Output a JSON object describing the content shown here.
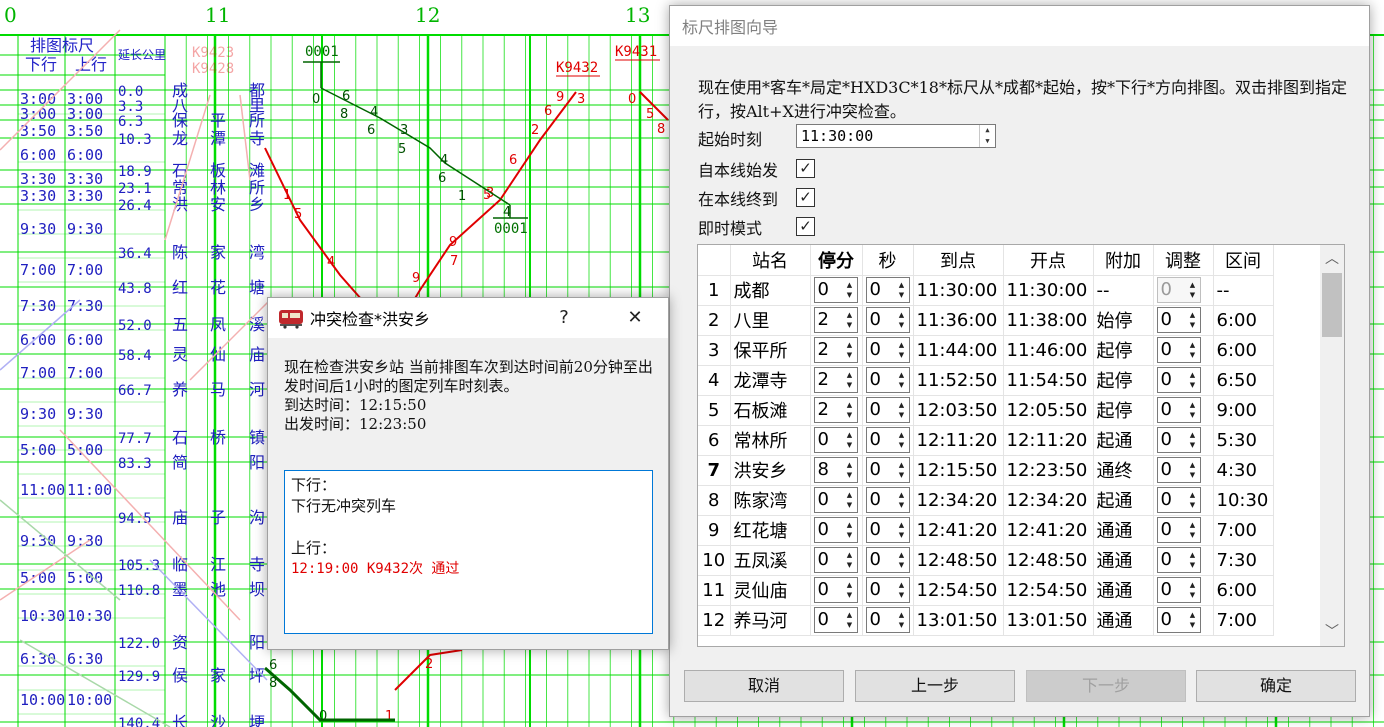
{
  "graph": {
    "hour_labels": [
      "0",
      "11",
      "12",
      "13"
    ],
    "ruler_header": "排图标尺",
    "down_header": "下行",
    "up_header": "上行",
    "km_header": "延长公里",
    "ruler_rows": [
      {
        "down": "3:00",
        "up": "3:00"
      },
      {
        "down": "3:00",
        "up": "3:00"
      },
      {
        "down": "3:50",
        "up": "3:50"
      },
      {
        "down": "6:00",
        "up": "6:00"
      },
      {
        "down": "3:30",
        "up": "3:30"
      },
      {
        "down": "3:30",
        "up": "3:30"
      },
      {
        "down": "9:30",
        "up": "9:30"
      },
      {
        "down": "7:00",
        "up": "7:00"
      },
      {
        "down": "7:30",
        "up": "7:30"
      },
      {
        "down": "6:00",
        "up": "6:00"
      },
      {
        "down": "7:00",
        "up": "7:00"
      },
      {
        "down": "9:30",
        "up": "9:30"
      },
      {
        "down": "5:00",
        "up": "5:00"
      },
      {
        "down": "11:00",
        "up": "11:00"
      },
      {
        "down": "9:30",
        "up": "9:30"
      },
      {
        "down": "5:00",
        "up": "5:00"
      },
      {
        "down": "10:30",
        "up": "10:30"
      },
      {
        "down": "6:30",
        "up": "6:30"
      },
      {
        "down": "10:00",
        "up": "10:00"
      }
    ],
    "stations": [
      {
        "km": "0.0",
        "name": [
          "成",
          "",
          "都"
        ]
      },
      {
        "km": "3.3",
        "name": [
          "八",
          "",
          "里"
        ]
      },
      {
        "km": "6.3",
        "name": [
          "保",
          "平",
          "所"
        ]
      },
      {
        "km": "10.3",
        "name": [
          "龙",
          "潭",
          "寺"
        ]
      },
      {
        "km": "18.9",
        "name": [
          "石",
          "板",
          "滩"
        ]
      },
      {
        "km": "23.1",
        "name": [
          "常",
          "林",
          "所"
        ]
      },
      {
        "km": "26.4",
        "name": [
          "洪",
          "安",
          "乡"
        ]
      },
      {
        "km": "36.4",
        "name": [
          "陈",
          "家",
          "湾"
        ]
      },
      {
        "km": "43.8",
        "name": [
          "红",
          "花",
          "塘"
        ]
      },
      {
        "km": "52.0",
        "name": [
          "五",
          "凤",
          "溪"
        ]
      },
      {
        "km": "58.4",
        "name": [
          "灵",
          "仙",
          "庙"
        ]
      },
      {
        "km": "66.7",
        "name": [
          "养",
          "马",
          "河"
        ]
      },
      {
        "km": "77.7",
        "name": [
          "石",
          "桥",
          "镇"
        ]
      },
      {
        "km": "83.3",
        "name": [
          "简",
          "",
          "阳"
        ]
      },
      {
        "km": "94.5",
        "name": [
          "庙",
          "子",
          "沟"
        ]
      },
      {
        "km": "105.3",
        "name": [
          "临",
          "江",
          "寺"
        ]
      },
      {
        "km": "110.8",
        "name": [
          "墨",
          "池",
          "坝"
        ]
      },
      {
        "km": "122.0",
        "name": [
          "资",
          "",
          "阳"
        ]
      },
      {
        "km": "129.9",
        "name": [
          "侯",
          "家",
          "坪"
        ]
      },
      {
        "km": "140.4",
        "name": [
          "长",
          "沙",
          "埂"
        ]
      }
    ],
    "train_labels": {
      "k9423": "K9423",
      "k9428": "K9428",
      "k9432": "K9432",
      "k9431": "K9431",
      "t0001_top": "0001",
      "t0001_bottom": "0001"
    },
    "colors": {
      "grid": "#00dc00",
      "train_down": "#e00000",
      "train_up": "#006400",
      "text": "#2020c0"
    }
  },
  "wizard": {
    "title": "标尺排图向导",
    "description": "现在使用*客车*局定*HXD3C*18*标尺从*成都*起始，按*下行*方向排图。双击排图到指定行，按Alt+X进行冲突检查。",
    "start_label": "起始时刻",
    "start_value": "11:30:00",
    "origin_label": "自本线始发",
    "terminal_label": "在本线终到",
    "instant_label": "即时模式",
    "check_mark": "✓",
    "columns": [
      "",
      "站名",
      "停分",
      "秒",
      "到点",
      "开点",
      "附加",
      "调整",
      "区间"
    ],
    "rows": [
      {
        "n": "1",
        "station": "成都",
        "stop": "0",
        "sec": "0",
        "arr": "11:30:00",
        "dep": "11:30:00",
        "extra": "--",
        "adj": "0",
        "interval": "--"
      },
      {
        "n": "2",
        "station": "八里",
        "stop": "2",
        "sec": "0",
        "arr": "11:36:00",
        "dep": "11:38:00",
        "extra": "始停",
        "adj": "0",
        "interval": "6:00"
      },
      {
        "n": "3",
        "station": "保平所",
        "stop": "2",
        "sec": "0",
        "arr": "11:44:00",
        "dep": "11:46:00",
        "extra": "起停",
        "adj": "0",
        "interval": "6:00"
      },
      {
        "n": "4",
        "station": "龙潭寺",
        "stop": "2",
        "sec": "0",
        "arr": "11:52:50",
        "dep": "11:54:50",
        "extra": "起停",
        "adj": "0",
        "interval": "6:50"
      },
      {
        "n": "5",
        "station": "石板滩",
        "stop": "2",
        "sec": "0",
        "arr": "12:03:50",
        "dep": "12:05:50",
        "extra": "起停",
        "adj": "0",
        "interval": "9:00"
      },
      {
        "n": "6",
        "station": "常林所",
        "stop": "0",
        "sec": "0",
        "arr": "12:11:20",
        "dep": "12:11:20",
        "extra": "起通",
        "adj": "0",
        "interval": "5:30"
      },
      {
        "n": "7",
        "station": "洪安乡",
        "stop": "8",
        "sec": "0",
        "arr": "12:15:50",
        "dep": "12:23:50",
        "extra": "通终",
        "adj": "0",
        "interval": "4:30"
      },
      {
        "n": "8",
        "station": "陈家湾",
        "stop": "0",
        "sec": "0",
        "arr": "12:34:20",
        "dep": "12:34:20",
        "extra": "起通",
        "adj": "0",
        "interval": "10:30"
      },
      {
        "n": "9",
        "station": "红花塘",
        "stop": "0",
        "sec": "0",
        "arr": "12:41:20",
        "dep": "12:41:20",
        "extra": "通通",
        "adj": "0",
        "interval": "7:00"
      },
      {
        "n": "10",
        "station": "五凤溪",
        "stop": "0",
        "sec": "0",
        "arr": "12:48:50",
        "dep": "12:48:50",
        "extra": "通通",
        "adj": "0",
        "interval": "7:30"
      },
      {
        "n": "11",
        "station": "灵仙庙",
        "stop": "0",
        "sec": "0",
        "arr": "12:54:50",
        "dep": "12:54:50",
        "extra": "通通",
        "adj": "0",
        "interval": "6:00"
      },
      {
        "n": "12",
        "station": "养马河",
        "stop": "0",
        "sec": "0",
        "arr": "13:01:50",
        "dep": "13:01:50",
        "extra": "通通",
        "adj": "0",
        "interval": "7:00"
      }
    ],
    "buttons": {
      "cancel": "取消",
      "prev": "上一步",
      "next": "下一步",
      "ok": "确定"
    }
  },
  "conflict": {
    "title": "冲突检查*洪安乡",
    "help": "?",
    "close": "✕",
    "description": "现在检查洪安乡站 当前排图车次到达时间前20分钟至出发时间后1小时的图定列车时刻表。",
    "arrival": "到达时间：12:15:50",
    "departure": "出发时间：12:23:50",
    "down_header": "下行：",
    "down_result": "下行无冲突列车",
    "up_header": "上行：",
    "up_result": "12:19:00 K9432次 通过"
  }
}
